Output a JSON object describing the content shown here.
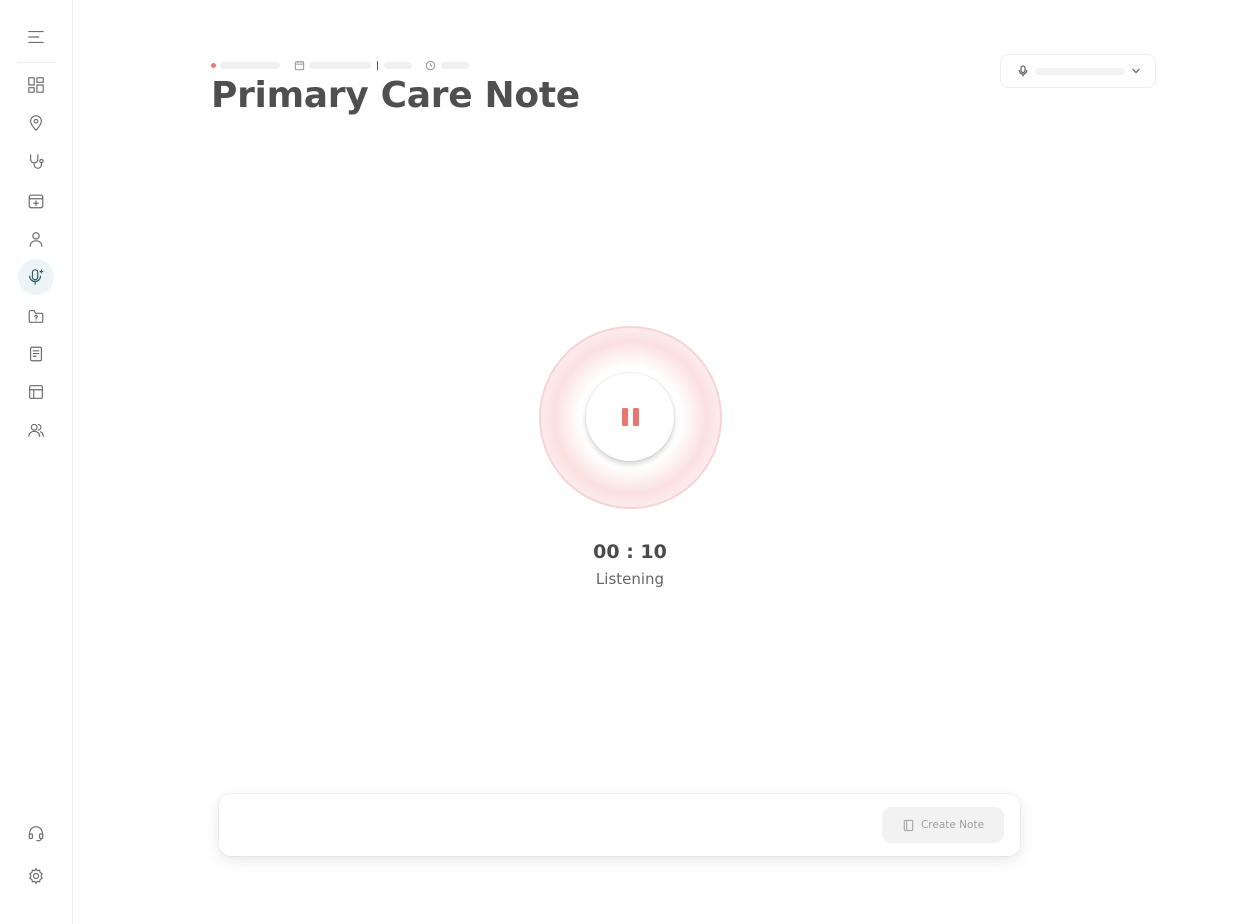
{
  "sidebar": {
    "items": [
      {
        "icon": "dashboard-icon",
        "label": ""
      },
      {
        "icon": "location-pin-icon",
        "label": ""
      },
      {
        "icon": "stethoscope-icon",
        "label": ""
      },
      {
        "icon": "calendar-add-icon",
        "label": ""
      },
      {
        "icon": "user-icon",
        "label": ""
      },
      {
        "icon": "ai-microphone-icon",
        "label": "",
        "active": true
      },
      {
        "icon": "folder-question-icon",
        "label": ""
      },
      {
        "icon": "document-icon",
        "label": ""
      },
      {
        "icon": "layout-table-icon",
        "label": ""
      },
      {
        "icon": "users-icon",
        "label": ""
      }
    ],
    "bottom": [
      {
        "icon": "headset-icon"
      },
      {
        "icon": "gear-icon"
      }
    ]
  },
  "header": {
    "title": "Primary Care Note",
    "status_color": "#ec7b77"
  },
  "mic_select": {
    "icon": "microphone-icon",
    "value": ""
  },
  "recorder": {
    "state_icon": "pause-icon",
    "timer": "00 : 10",
    "status": "Listening",
    "accent_color": "#e87770"
  },
  "bottom_bar": {
    "create_note_label": "Create Note",
    "create_note_icon": "notebook-icon"
  }
}
